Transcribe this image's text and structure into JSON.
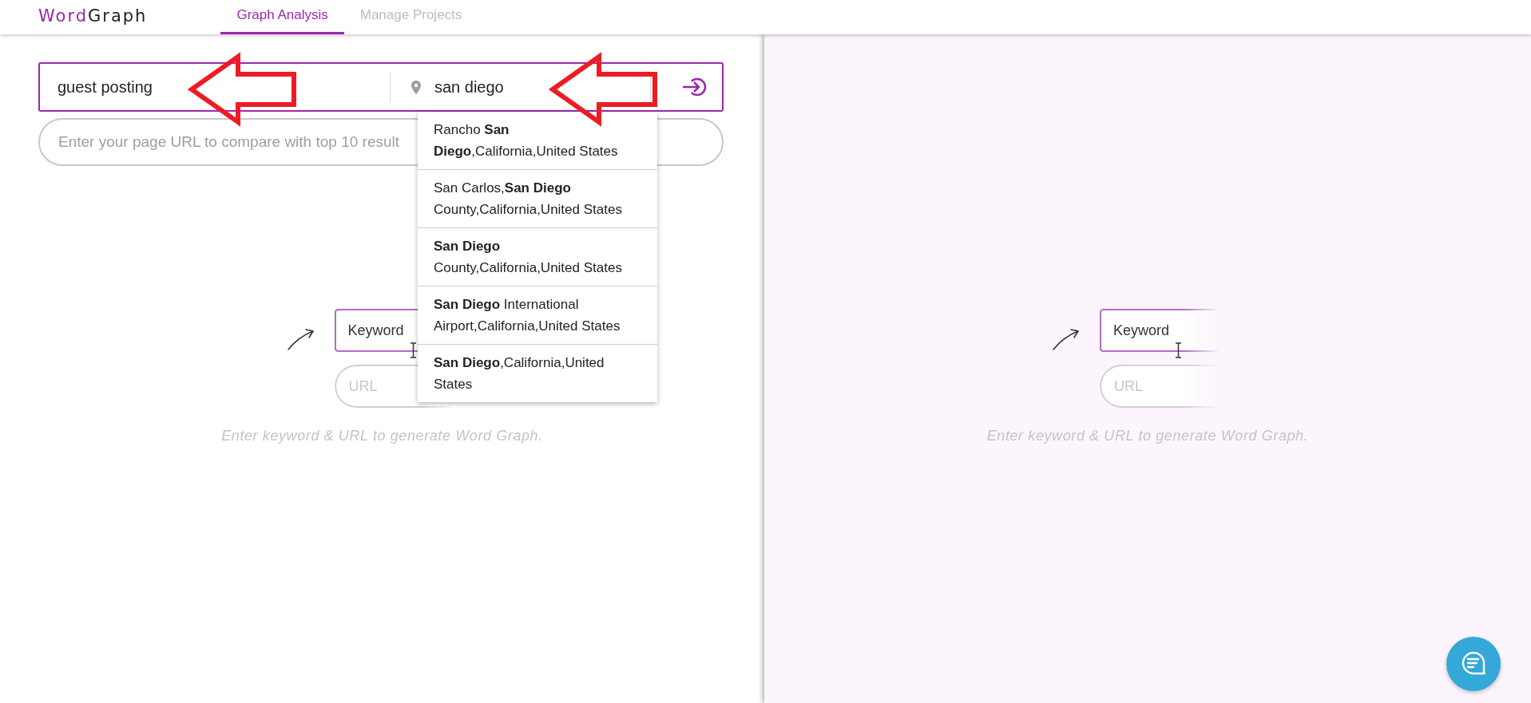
{
  "header": {
    "logo": {
      "first": "Word",
      "second": "Graph"
    },
    "tabs": [
      {
        "label": "Graph Analysis",
        "selected": true
      },
      {
        "label": "Manage Projects",
        "selected": false
      }
    ]
  },
  "search": {
    "keyword": "guest posting",
    "location": "san diego",
    "url_placeholder": "Enter your page URL to compare with top 10 result",
    "suggestions": [
      "Rancho **San Diego**,California,United States",
      "San Carlos,**San Diego** County,California,United States",
      "**San Diego** County,California,United States",
      "**San Diego** International Airport,California,United States",
      "**San Diego**,California,United States"
    ]
  },
  "panels": [
    {
      "keyword_label": "Keyword",
      "url_placeholder": "URL",
      "caption": "Enter keyword & URL to generate Word Graph."
    },
    {
      "keyword_label": "Keyword",
      "url_placeholder": "URL",
      "caption": "Enter keyword & URL to generate Word Graph."
    }
  ]
}
